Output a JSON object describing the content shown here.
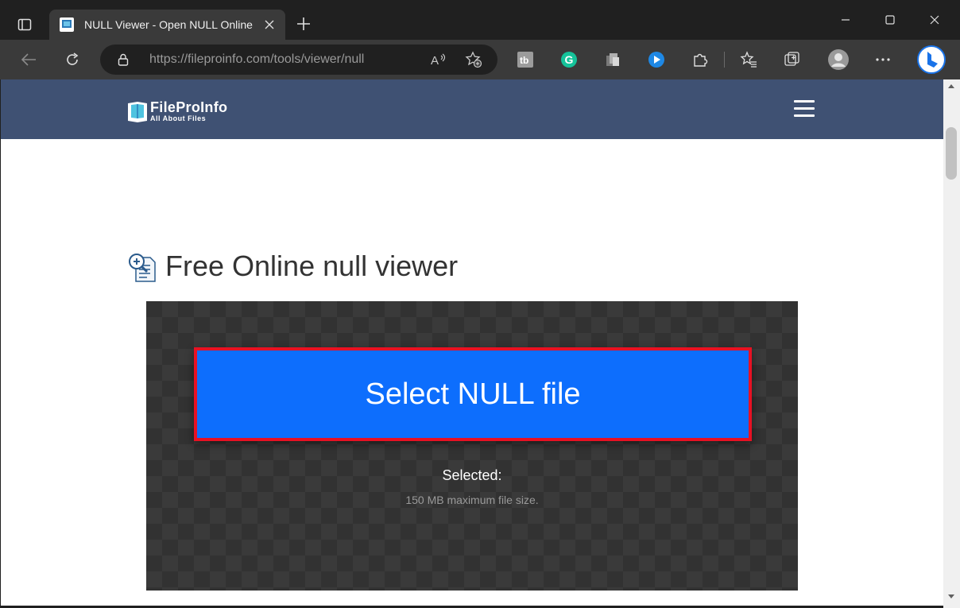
{
  "browser": {
    "tab": {
      "title": "NULL Viewer - Open NULL Online"
    },
    "address_bar": {
      "url_host": "https://fileproinfo.com",
      "url_path": "/tools/viewer/null"
    },
    "icons": {
      "tab_actions": "tab-actions-icon",
      "favicon": "fileproinfo-favicon",
      "close_tab": "close-icon",
      "new_tab": "plus-icon",
      "minimize": "minimize-icon",
      "maximize": "maximize-icon",
      "close_window": "close-icon",
      "back": "back-arrow-icon",
      "refresh": "refresh-icon",
      "lock": "lock-icon",
      "read_aloud": "read-aloud-icon",
      "add_favorite": "add-favorite-icon",
      "extension_1": "tb-extension-icon",
      "extension_2": "grammarly-icon",
      "extension_3": "copy-extension-icon",
      "extension_4": "media-extension-icon",
      "extensions": "puzzle-icon",
      "favorites": "favorites-icon",
      "collections": "collections-icon",
      "profile": "profile-avatar",
      "more": "more-icon",
      "copilot": "bing-copilot-icon"
    }
  },
  "site": {
    "logo": {
      "brand": "FileProInfo",
      "tagline": "All About Files"
    },
    "page_title": "Free Online null viewer",
    "upload": {
      "button_label": "Select NULL file",
      "selected_label": "Selected:",
      "max_size_note": "150 MB maximum file size."
    }
  },
  "colors": {
    "header_bg": "#3f5173",
    "button_bg": "#0d6efd",
    "highlight_border": "#e81123",
    "dropzone_bg": "#323232"
  }
}
